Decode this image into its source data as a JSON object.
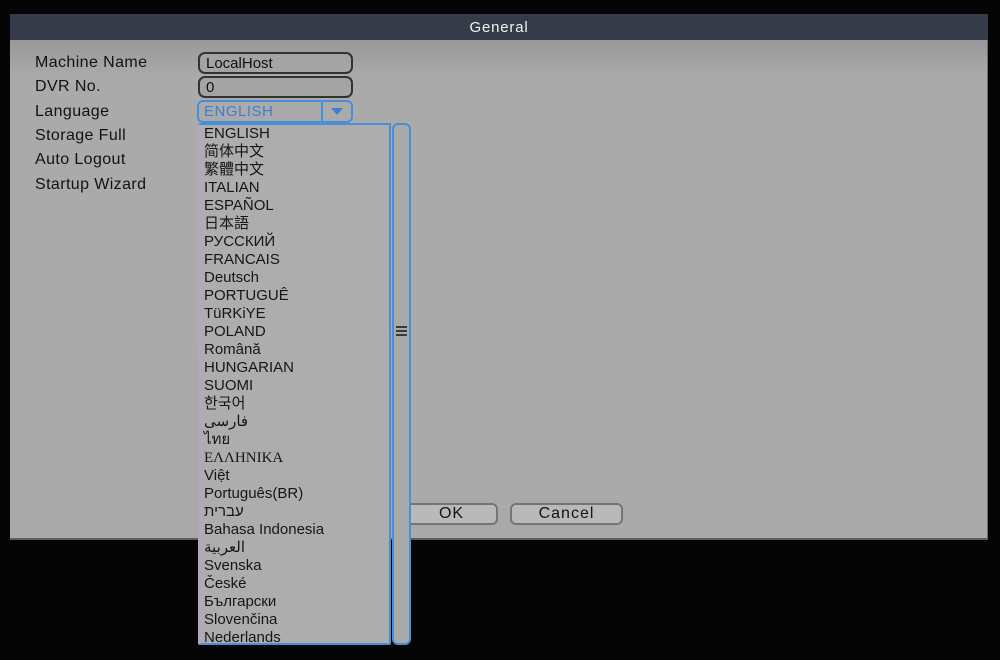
{
  "window": {
    "title": "General"
  },
  "form": {
    "fields": [
      {
        "label": "Machine Name",
        "value": "LocalHost"
      },
      {
        "label": "DVR No.",
        "value": "0"
      },
      {
        "label": "Language"
      },
      {
        "label": "Storage Full"
      },
      {
        "label": "Auto Logout"
      },
      {
        "label": "Startup Wizard"
      }
    ]
  },
  "language_dropdown": {
    "selected": "ENGLISH",
    "options": [
      "ENGLISH",
      "简体中文",
      "繁體中文",
      "ITALIAN",
      "ESPAÑOL",
      "日本語",
      "РУССКИЙ",
      "FRANCAIS",
      "Deutsch",
      "PORTUGUÊ",
      "TüRKiYE",
      "POLAND",
      "Română",
      "HUNGARIAN",
      "SUOMI",
      "한국어",
      "فارسی",
      "ไทย",
      "ΕΛΛΗΝΙΚΑ",
      "Việt",
      "Português(BR)",
      "עברית",
      "Bahasa Indonesia",
      "العربية",
      "Svenska",
      "České",
      "Български",
      "Slovenčina",
      "Nederlands"
    ],
    "serif_option": "ΕΛΛΗΝΙΚΑ"
  },
  "buttons": {
    "ok": "OK",
    "cancel": "Cancel"
  },
  "colors": {
    "accent_blue": "#4a8ed6",
    "blue_text": "#3d7fd4",
    "titlebar": "#353b49",
    "panel": "#a9a9a9",
    "background": "#050505"
  }
}
